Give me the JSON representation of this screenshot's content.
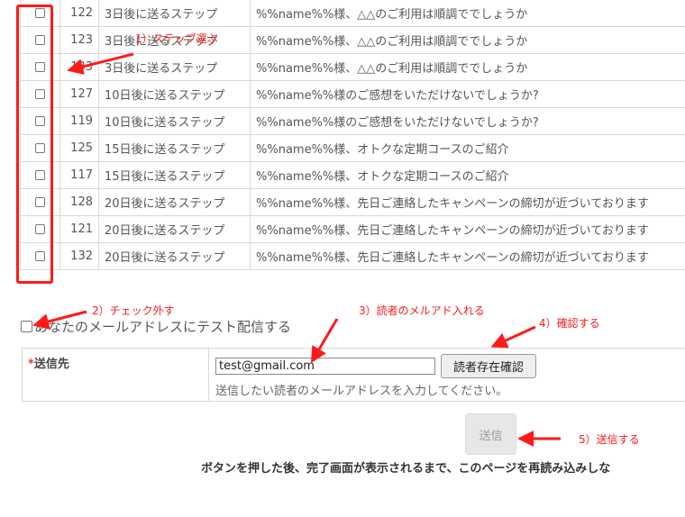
{
  "steps": [
    {
      "id": "122",
      "name": "3日後に送るステップ",
      "subject": "%%name%%様、△△のご利用は順調ででしょうか"
    },
    {
      "id": "123",
      "name": "3日後に送るステップ",
      "subject": "%%name%%様、△△のご利用は順調ででしょうか"
    },
    {
      "id": "133",
      "name": "3日後に送るステップ",
      "subject": "%%name%%様、△△のご利用は順調ででしょうか"
    },
    {
      "id": "127",
      "name": "10日後に送るステップ",
      "subject": "%%name%%様のご感想をいただけないでしょうか?"
    },
    {
      "id": "119",
      "name": "10日後に送るステップ",
      "subject": "%%name%%様のご感想をいただけないでしょうか?"
    },
    {
      "id": "125",
      "name": "15日後に送るステップ",
      "subject": "%%name%%様、オトクな定期コースのご紹介"
    },
    {
      "id": "117",
      "name": "15日後に送るステップ",
      "subject": "%%name%%様、オトクな定期コースのご紹介"
    },
    {
      "id": "128",
      "name": "20日後に送るステップ",
      "subject": "%%name%%様、先日ご連絡したキャンペーンの締切が近づいております"
    },
    {
      "id": "121",
      "name": "20日後に送るステップ",
      "subject": "%%name%%様、先日ご連絡したキャンペーンの締切が近づいております"
    },
    {
      "id": "132",
      "name": "20日後に送るステップ",
      "subject": "%%name%%様、先日ご連絡したキャンペーンの締切が近づいております"
    }
  ],
  "test_send_label": "あなたのメールアドレスにテスト配信する",
  "destination": {
    "required_mark": "*",
    "label": "送信先",
    "email_value": "test@gmail.com",
    "confirm_button": "読者存在確認",
    "help_text": "送信したい読者のメールアドレスを入力してください。"
  },
  "send_button": "送信",
  "note": "ボタンを押した後、完了画面が表示されるまで、このページを再読み込みしな",
  "annotations": {
    "step1": "1）ステップ選ぶ",
    "step2": "2）チェック外す",
    "step3": "3）読者のメルアド入れる",
    "step4": "4）確認する",
    "step5": "5）送信する",
    "color": "#ff1a1a"
  }
}
